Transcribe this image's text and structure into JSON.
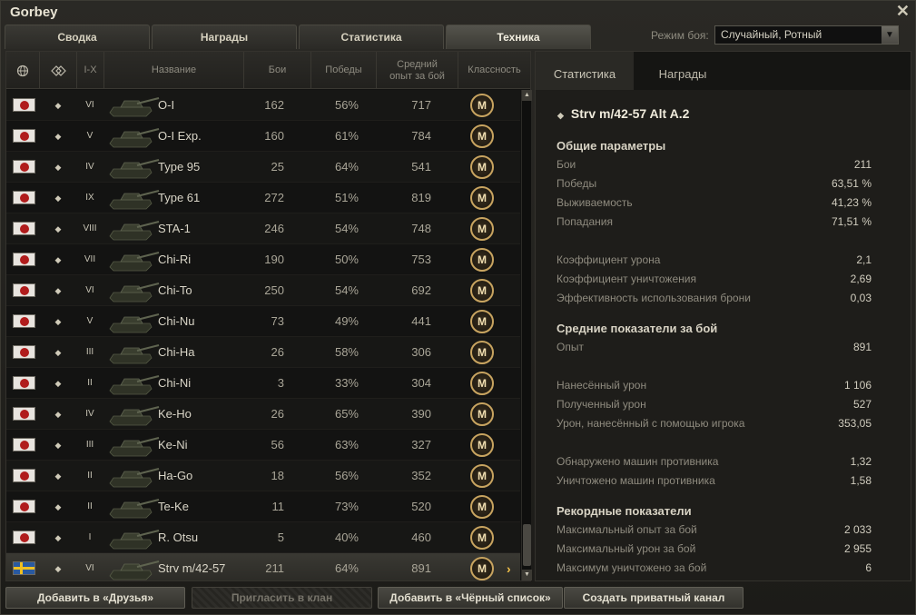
{
  "window": {
    "title": "Gorbey",
    "close_label": "✕"
  },
  "tabs": [
    {
      "label": "Сводка",
      "active": false
    },
    {
      "label": "Награды",
      "active": false
    },
    {
      "label": "Статистика",
      "active": false
    },
    {
      "label": "Техника",
      "active": true
    }
  ],
  "battle_mode": {
    "label": "Режим боя:",
    "value": "Случайный, Ротный"
  },
  "table": {
    "headers": {
      "tier_range": "I-X",
      "name": "Название",
      "battles": "Бои",
      "wins": "Победы",
      "avg_xp_line1": "Средний",
      "avg_xp_line2": "опыт за бой",
      "mastery": "Классность"
    },
    "rows": [
      {
        "nation": "japan",
        "tier": "VI",
        "name": "O-I",
        "battles": "162",
        "wins": "56%",
        "xp": "717",
        "mastery": "M"
      },
      {
        "nation": "japan",
        "tier": "V",
        "name": "O-I Exp.",
        "battles": "160",
        "wins": "61%",
        "xp": "784",
        "mastery": "M"
      },
      {
        "nation": "japan",
        "tier": "IV",
        "name": "Type 95",
        "battles": "25",
        "wins": "64%",
        "xp": "541",
        "mastery": "M"
      },
      {
        "nation": "japan",
        "tier": "IX",
        "name": "Type 61",
        "battles": "272",
        "wins": "51%",
        "xp": "819",
        "mastery": "M"
      },
      {
        "nation": "japan",
        "tier": "VIII",
        "name": "STA-1",
        "battles": "246",
        "wins": "54%",
        "xp": "748",
        "mastery": "M"
      },
      {
        "nation": "japan",
        "tier": "VII",
        "name": "Chi-Ri",
        "battles": "190",
        "wins": "50%",
        "xp": "753",
        "mastery": "M"
      },
      {
        "nation": "japan",
        "tier": "VI",
        "name": "Chi-To",
        "battles": "250",
        "wins": "54%",
        "xp": "692",
        "mastery": "M"
      },
      {
        "nation": "japan",
        "tier": "V",
        "name": "Chi-Nu",
        "battles": "73",
        "wins": "49%",
        "xp": "441",
        "mastery": "M"
      },
      {
        "nation": "japan",
        "tier": "III",
        "name": "Chi-Ha",
        "battles": "26",
        "wins": "58%",
        "xp": "306",
        "mastery": "M"
      },
      {
        "nation": "japan",
        "tier": "II",
        "name": "Chi-Ni",
        "battles": "3",
        "wins": "33%",
        "xp": "304",
        "mastery": "M"
      },
      {
        "nation": "japan",
        "tier": "IV",
        "name": "Ke-Ho",
        "battles": "26",
        "wins": "65%",
        "xp": "390",
        "mastery": "M"
      },
      {
        "nation": "japan",
        "tier": "III",
        "name": "Ke-Ni",
        "battles": "56",
        "wins": "63%",
        "xp": "327",
        "mastery": "M"
      },
      {
        "nation": "japan",
        "tier": "II",
        "name": "Ha-Go",
        "battles": "18",
        "wins": "56%",
        "xp": "352",
        "mastery": "M"
      },
      {
        "nation": "japan",
        "tier": "II",
        "name": "Te-Ke",
        "battles": "11",
        "wins": "73%",
        "xp": "520",
        "mastery": "M"
      },
      {
        "nation": "japan",
        "tier": "I",
        "name": "R. Otsu",
        "battles": "5",
        "wins": "40%",
        "xp": "460",
        "mastery": "M"
      },
      {
        "nation": "sweden",
        "tier": "VI",
        "name": "Strv m/42-57",
        "battles": "211",
        "wins": "64%",
        "xp": "891",
        "mastery": "M",
        "selected": true
      }
    ]
  },
  "details": {
    "tabs": [
      "Статистика",
      "Награды"
    ],
    "vehicle_name": "Strv m/42-57 Alt A.2",
    "sections": [
      {
        "title": "Общие параметры",
        "stats": [
          {
            "k": "Бои",
            "v": "211"
          },
          {
            "k": "Победы",
            "v": "63,51 %"
          },
          {
            "k": "Выживаемость",
            "v": "41,23 %"
          },
          {
            "k": "Попадания",
            "v": "71,51 %"
          },
          {
            "k": "Коэффициент урона",
            "v": "2,1"
          },
          {
            "k": "Коэффициент уничтожения",
            "v": "2,69"
          },
          {
            "k": "Эффективность использования брони",
            "v": "0,03"
          }
        ]
      },
      {
        "title": "Средние показатели за бой",
        "stats": [
          {
            "k": "Опыт",
            "v": "891"
          },
          {
            "k": "Нанесённый урон",
            "v": "1 106"
          },
          {
            "k": "Полученный урон",
            "v": "527"
          },
          {
            "k": "Урон, нанесённый с помощью игрока",
            "v": "353,05"
          },
          {
            "k": "Обнаружено машин противника",
            "v": "1,32"
          },
          {
            "k": "Уничтожено машин противника",
            "v": "1,58"
          }
        ]
      },
      {
        "title": "Рекордные показатели",
        "stats": [
          {
            "k": "Максимальный опыт за бой",
            "v": "2 033"
          },
          {
            "k": "Максимальный урон за бой",
            "v": "2 955"
          },
          {
            "k": "Максимум уничтожено за бой",
            "v": "6"
          }
        ]
      }
    ]
  },
  "buttons": {
    "add_friend": "Добавить в «Друзья»",
    "invite_clan": "Пригласить в клан",
    "add_blacklist": "Добавить в «Чёрный список»",
    "private_channel": "Создать приватный канал"
  },
  "colors": {
    "accent_gold": "#c8a460",
    "chevron": "#f3c24a"
  }
}
